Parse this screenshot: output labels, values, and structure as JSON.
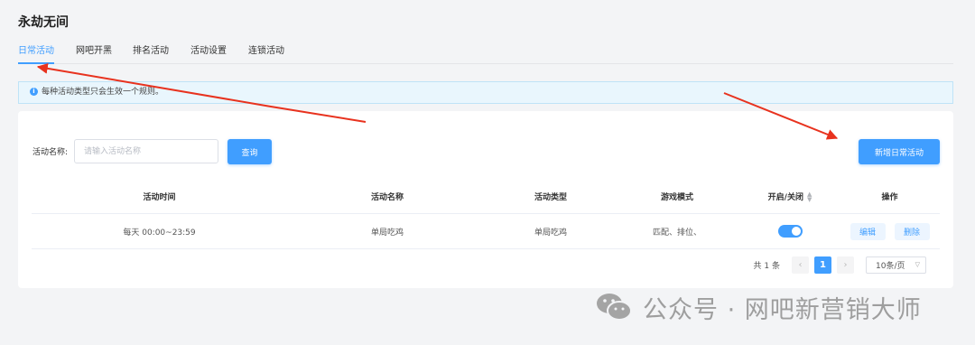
{
  "page": {
    "title": "永劫无间"
  },
  "tabs": [
    {
      "label": "日常活动",
      "active": true
    },
    {
      "label": "网吧开黑"
    },
    {
      "label": "排名活动"
    },
    {
      "label": "活动设置"
    },
    {
      "label": "连锁活动"
    }
  ],
  "alert": {
    "text": "每种活动类型只会生效一个规则。",
    "icon": "info-icon"
  },
  "filter": {
    "label": "活动名称:",
    "placeholder": "请输入活动名称",
    "query_label": "查询",
    "add_label": "新增日常活动"
  },
  "table": {
    "headers": [
      "活动时间",
      "活动名称",
      "活动类型",
      "游戏模式",
      "开启/关闭",
      "操作"
    ],
    "rows": [
      {
        "time": "每天 00:00~23:59",
        "name": "单局吃鸡",
        "type": "单局吃鸡",
        "mode": "匹配、排位、",
        "enabled": true,
        "edit": "编辑",
        "delete": "删除"
      }
    ]
  },
  "pagination": {
    "total": "共 1 条",
    "prev": "‹",
    "current": "1",
    "next": "›",
    "page_size": "10条/页"
  },
  "watermark": {
    "text": "公众号 · 网吧新营销大师",
    "icon": "wechat-icon"
  },
  "colors": {
    "accent": "#409eff",
    "arrow": "#e8321e",
    "alert_bg": "#e9f6fd"
  }
}
